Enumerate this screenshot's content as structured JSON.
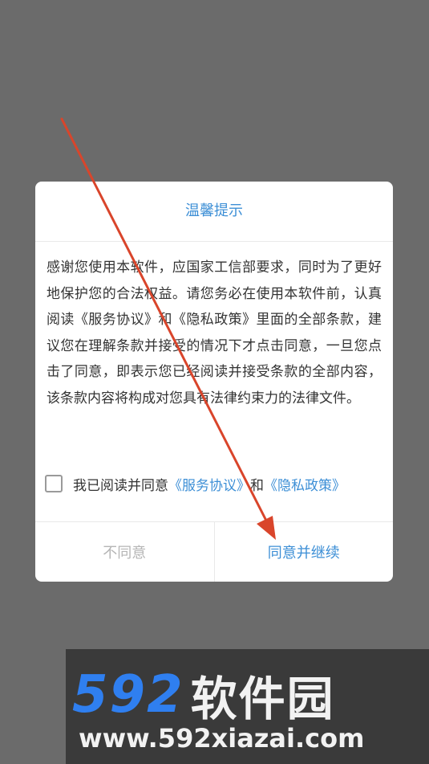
{
  "dialog": {
    "title": "温馨提示",
    "body": "感谢您使用本软件，应国家工信部要求，同时为了更好地保护您的合法权益。请您务必在使用本软件前，认真阅读《服务协议》和《隐私政策》里面的全部条款，建议您在理解条款并接受的情况下才点击同意，一旦您点击了同意，即表示您已经阅读并接受条款的全部内容，该条款内容将构成对您具有法律约束力的法律文件。",
    "agree_prefix": "我已阅读并同意",
    "service_link": "《服务协议》",
    "and_text": "和",
    "privacy_link": "《隐私政策》",
    "disagree_label": "不同意",
    "agree_label": "同意并继续"
  },
  "watermark": {
    "number": "592",
    "name": "软件园",
    "url": "www.592xiazai.com"
  },
  "colors": {
    "accent": "#3d8fd6",
    "overlay": "#6b6b6b",
    "arrow": "#d9452b",
    "disabled_text": "#b5b5b5"
  }
}
